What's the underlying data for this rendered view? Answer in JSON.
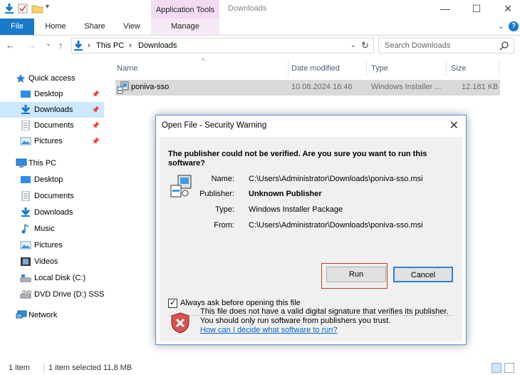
{
  "window": {
    "title": "Downloads",
    "context_tab": "Application Tools",
    "controls": {
      "minimize": "—",
      "maximize": "☐",
      "close": "✕"
    }
  },
  "ribbon": {
    "tabs": [
      "File",
      "Home",
      "Share",
      "View",
      "Manage"
    ],
    "help_chevron": "⌄",
    "help": "?"
  },
  "address": {
    "back": "←",
    "forward": "→",
    "recent": "⌄",
    "up": "↑",
    "sep": "›",
    "crumbs": [
      "This PC",
      "Downloads"
    ],
    "dropdown": "⌄",
    "refresh": "↻",
    "search_placeholder": "Search Downloads"
  },
  "sidebar": {
    "quick_access": "Quick access",
    "quick_items": [
      {
        "label": "Desktop",
        "pin": "📌"
      },
      {
        "label": "Downloads",
        "pin": "📌"
      },
      {
        "label": "Documents",
        "pin": "📌"
      },
      {
        "label": "Pictures",
        "pin": "📌"
      }
    ],
    "this_pc": "This PC",
    "pc_items": [
      "Desktop",
      "Documents",
      "Downloads",
      "Music",
      "Pictures",
      "Videos",
      "Local Disk (C:)",
      "DVD Drive (D:) SSS_X"
    ],
    "network": "Network"
  },
  "columns": {
    "name": "Name",
    "date": "Date modified",
    "type": "Type",
    "size": "Size",
    "sort_indicator": "^"
  },
  "files": [
    {
      "name": "poniva-sso",
      "date": "10.08.2024 16:46",
      "type": "Windows Installer ...",
      "size": "12.181 KB"
    }
  ],
  "status": {
    "count": "1 item",
    "selected": "1 item selected  11,8 MB"
  },
  "dialog": {
    "title": "Open File - Security Warning",
    "close": "✕",
    "question": "The publisher could not be verified.  Are you sure you want to run this software?",
    "fields": [
      {
        "key": "Name:",
        "value": "C:\\Users\\Administrator\\Downloads\\poniva-sso.msi",
        "bold": false
      },
      {
        "key": "Publisher:",
        "value": "Unknown Publisher",
        "bold": true
      },
      {
        "key": "Type:",
        "value": "Windows Installer Package",
        "bold": false
      },
      {
        "key": "From:",
        "value": "C:\\Users\\Administrator\\Downloads\\poniva-sso.msi",
        "bold": false
      }
    ],
    "run": "Run",
    "cancel": "Cancel",
    "checkbox_label": "Always ask before opening this file",
    "checkbox_checked": true,
    "checkmark": "✓",
    "warning": "This file does not have a valid digital signature that verifies its publisher.  You should only run software from publishers you trust.",
    "link": "How can I decide what software to run?"
  },
  "colors": {
    "accent": "#1979ca",
    "selected": "#cce8ff",
    "context_tab": "#f3dcf3",
    "highlight": "#c0392b"
  }
}
